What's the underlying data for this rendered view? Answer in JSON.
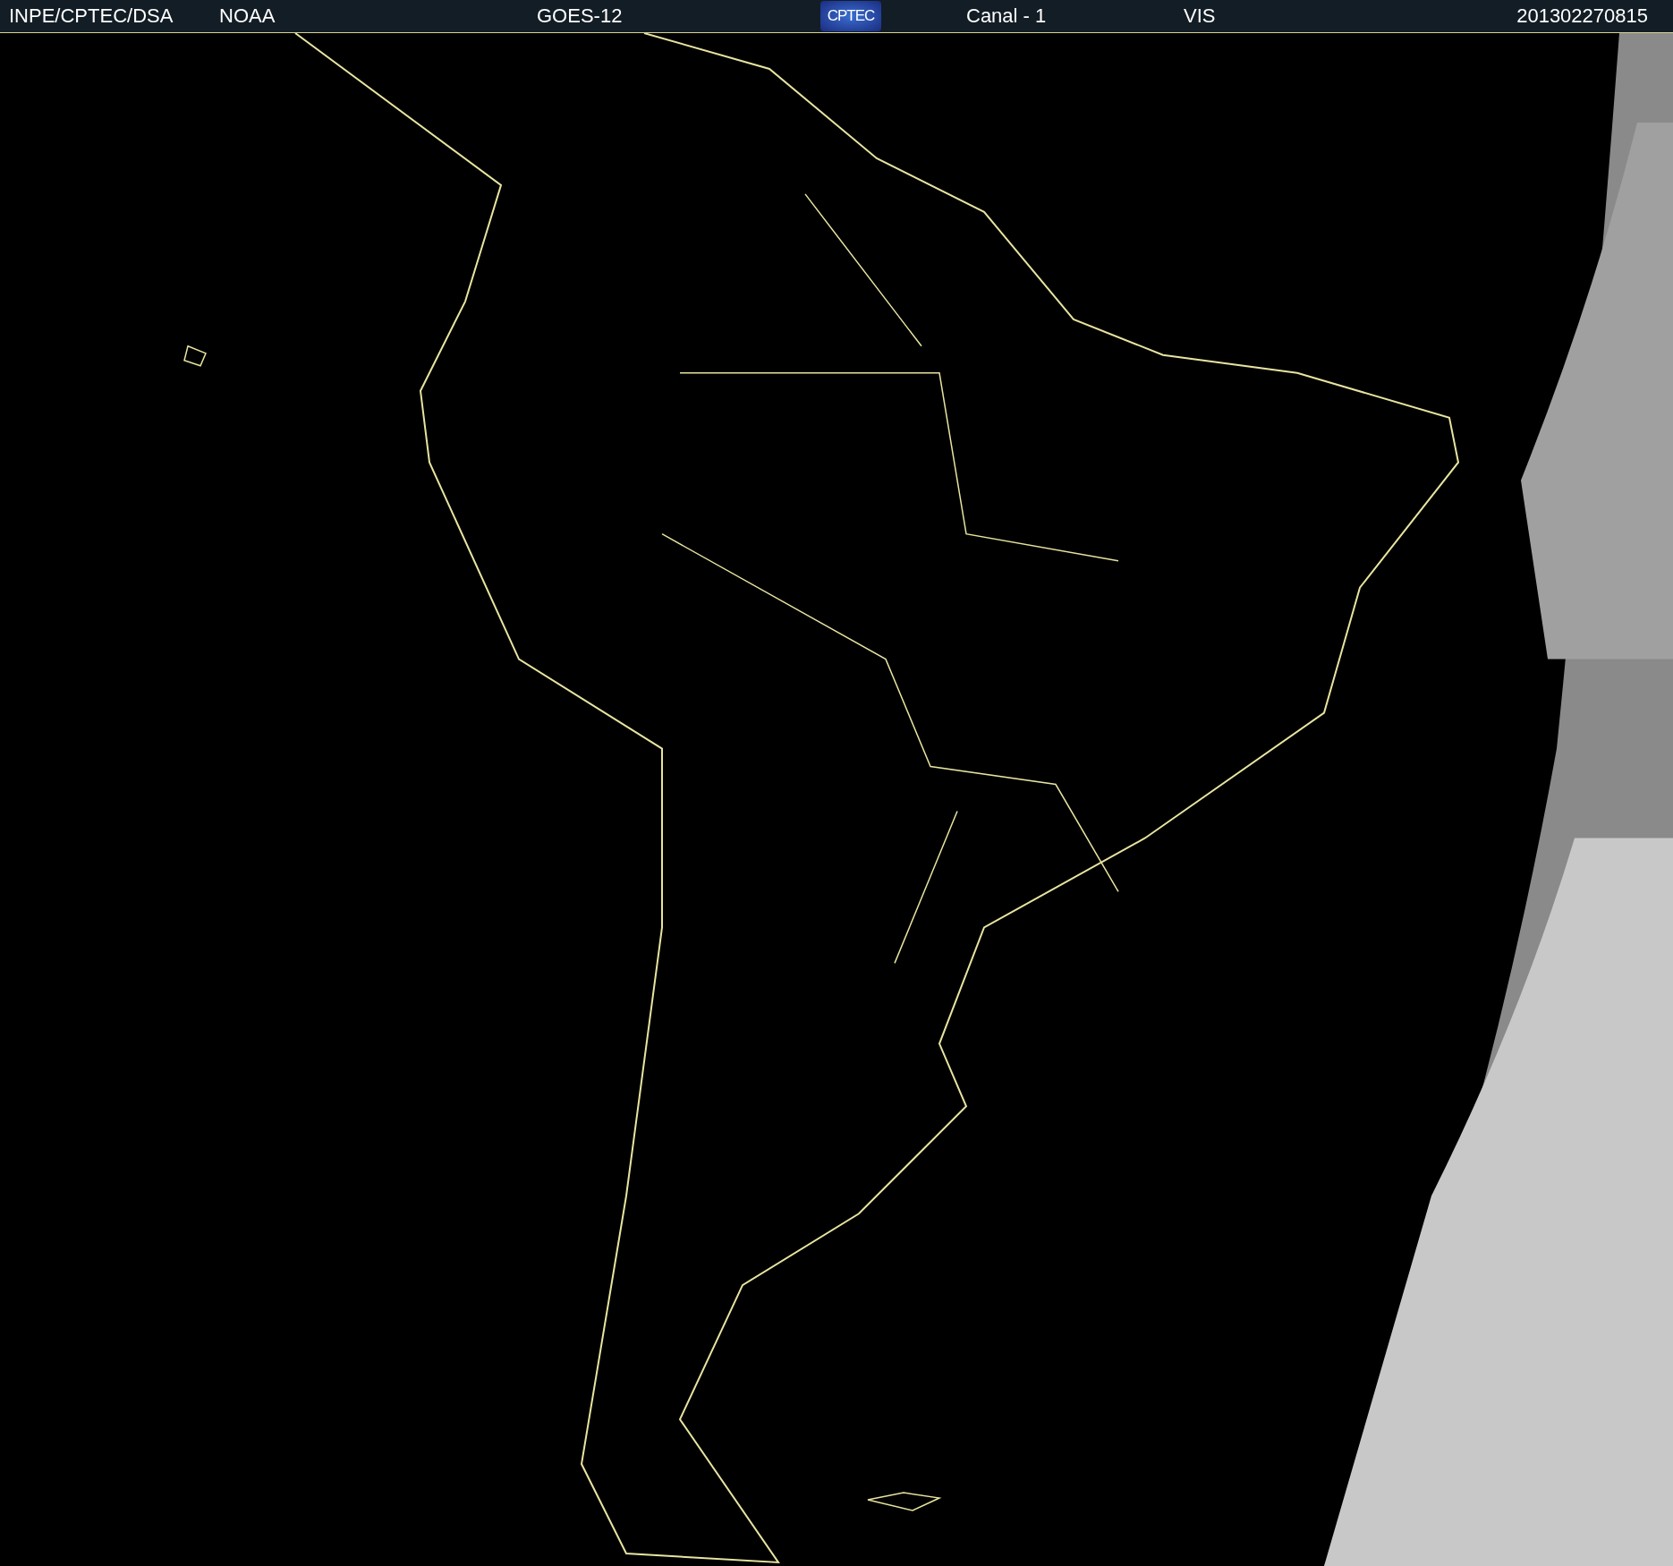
{
  "header": {
    "items": [
      {
        "kind": "text",
        "text": "INPE/CPTEC/DSA"
      },
      {
        "kind": "text",
        "text": "NOAA"
      },
      {
        "kind": "text",
        "text": "GOES-12"
      },
      {
        "kind": "logo",
        "text": "CPTEC"
      },
      {
        "kind": "text",
        "text": "Canal - 1"
      },
      {
        "kind": "text",
        "text": "VIS"
      },
      {
        "kind": "text",
        "text": "201302270815"
      }
    ]
  }
}
